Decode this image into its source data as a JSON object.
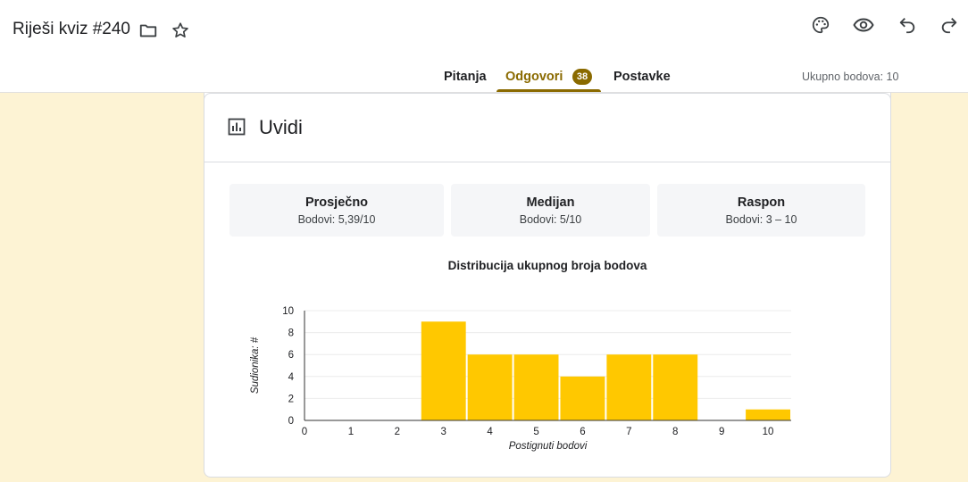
{
  "header": {
    "title": "Riješi kviz #240",
    "icons": {
      "folder": "folder-icon",
      "star": "star-icon",
      "palette": "palette-icon",
      "preview": "eye-icon",
      "undo": "undo-icon",
      "redo": "redo-icon"
    }
  },
  "tabs": [
    {
      "label": "Pitanja"
    },
    {
      "label": "Odgovori",
      "badge": "38",
      "active": true
    },
    {
      "label": "Postavke"
    }
  ],
  "total_points": "Ukupno bodova: 10",
  "insights": {
    "title": "Uvidi",
    "stats": [
      {
        "label": "Prosječno",
        "value": "Bodovi: 5,39/10"
      },
      {
        "label": "Medijan",
        "value": "Bodovi: 5/10"
      },
      {
        "label": "Raspon",
        "value": "Bodovi: 3 – 10"
      }
    ]
  },
  "colors": {
    "accent": "#8a6a00",
    "bar": "#ffc800",
    "background": "#fdf3d4"
  },
  "chart_data": {
    "type": "bar",
    "title": "Distribucija ukupnog broja bodova",
    "xlabel": "Postignuti bodovi",
    "ylabel": "Sudionika: #",
    "categories": [
      "0",
      "1",
      "2",
      "3",
      "4",
      "5",
      "6",
      "7",
      "8",
      "9",
      "10"
    ],
    "values": [
      0,
      0,
      0,
      9,
      6,
      6,
      4,
      6,
      6,
      0,
      1
    ],
    "ylim": [
      0,
      10
    ],
    "yticks": [
      "0",
      "2",
      "4",
      "6",
      "8",
      "10"
    ],
    "grid": true
  }
}
